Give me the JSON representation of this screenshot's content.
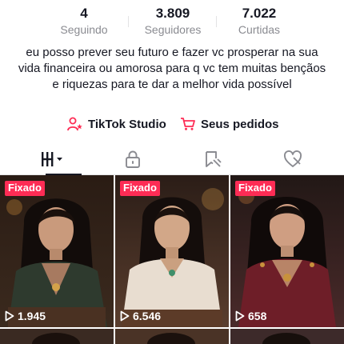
{
  "stats": [
    {
      "value": "4",
      "label": "Seguindo"
    },
    {
      "value": "3.809",
      "label": "Seguidores"
    },
    {
      "value": "7.022",
      "label": "Curtidas"
    }
  ],
  "bio": "eu posso prever seu futuro e fazer vc prosperar na sua vida financeira ou amorosa para q vc tem muitas bençãos e riquezas para te dar a melhor vida possível",
  "links": {
    "studio_label": "TikTok Studio",
    "orders_label": "Seus pedidos"
  },
  "tabs": [
    {
      "icon": "grid-videos-icon",
      "active": true
    },
    {
      "icon": "lock-icon",
      "active": false
    },
    {
      "icon": "repost-tag-icon",
      "active": false
    },
    {
      "icon": "liked-heart-icon",
      "active": false
    }
  ],
  "videos": [
    {
      "pinned_label": "Fixado",
      "views": "1.945"
    },
    {
      "pinned_label": "Fixado",
      "views": "6.546"
    },
    {
      "pinned_label": "Fixado",
      "views": "658"
    }
  ],
  "colors": {
    "accent": "#fe2c55",
    "text": "#161823",
    "secondary": "#8a8b91"
  }
}
